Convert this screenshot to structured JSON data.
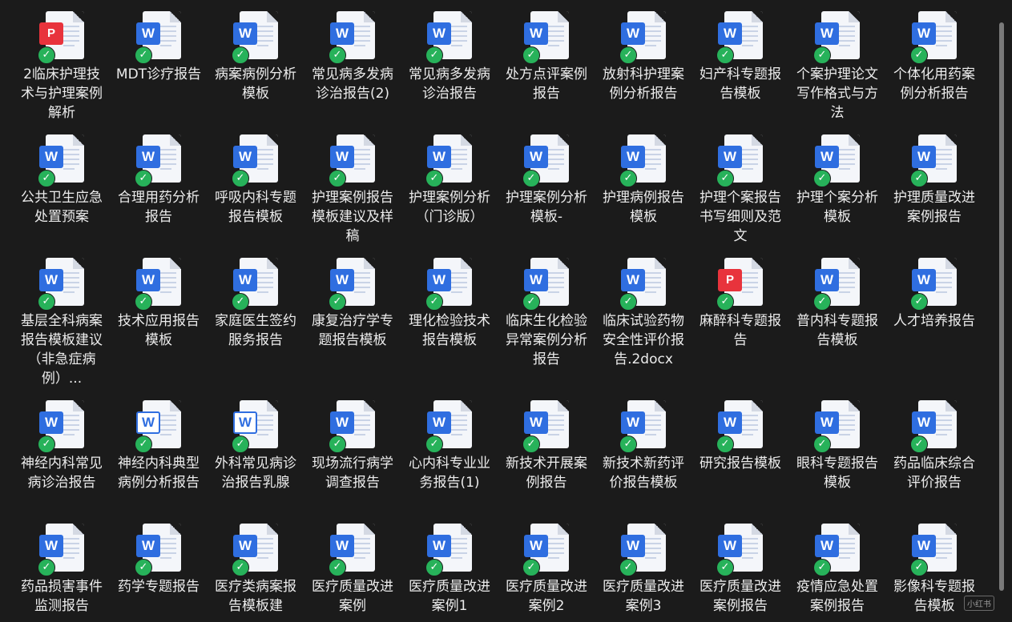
{
  "files": [
    {
      "name": "2临床护理技术与护理案例解析",
      "type": "wps"
    },
    {
      "name": "MDT诊疗报告",
      "type": "word"
    },
    {
      "name": "病案病例分析模板",
      "type": "word"
    },
    {
      "name": "常见病多发病诊治报告(2)",
      "type": "word"
    },
    {
      "name": "常见病多发病诊治报告",
      "type": "word"
    },
    {
      "name": "处方点评案例报告",
      "type": "word"
    },
    {
      "name": "放射科护理案例分析报告",
      "type": "word"
    },
    {
      "name": "妇产科专题报告模板",
      "type": "word"
    },
    {
      "name": "个案护理论文写作格式与方法",
      "type": "word"
    },
    {
      "name": "个体化用药案例分析报告",
      "type": "word"
    },
    {
      "name": "公共卫生应急处置预案",
      "type": "word"
    },
    {
      "name": "合理用药分析报告",
      "type": "word"
    },
    {
      "name": "呼吸内科专题报告模板",
      "type": "word"
    },
    {
      "name": "护理案例报告模板建议及样稿",
      "type": "word"
    },
    {
      "name": "护理案例分析（门诊版）",
      "type": "word"
    },
    {
      "name": "护理案例分析模板-",
      "type": "word"
    },
    {
      "name": "护理病例报告模板",
      "type": "word"
    },
    {
      "name": "护理个案报告书写细则及范文",
      "type": "word"
    },
    {
      "name": "护理个案分析模板",
      "type": "word"
    },
    {
      "name": "护理质量改进案例报告",
      "type": "word"
    },
    {
      "name": "基层全科病案报告模板建议（非急症病例）...",
      "type": "word"
    },
    {
      "name": "技术应用报告模板",
      "type": "word"
    },
    {
      "name": "家庭医生签约服务报告",
      "type": "word"
    },
    {
      "name": "康复治疗学专题报告模板",
      "type": "word"
    },
    {
      "name": "理化检验技术报告模板",
      "type": "word"
    },
    {
      "name": "临床生化检验异常案例分析报告",
      "type": "word"
    },
    {
      "name": "临床试验药物安全性评价报告.2docx",
      "type": "word"
    },
    {
      "name": "麻醉科专题报告",
      "type": "wps"
    },
    {
      "name": "普内科专题报告模板",
      "type": "word"
    },
    {
      "name": "人才培养报告",
      "type": "word"
    },
    {
      "name": "神经内科常见病诊治报告",
      "type": "word"
    },
    {
      "name": "神经内科典型病例分析报告",
      "type": "word-light"
    },
    {
      "name": "外科常见病诊治报告乳腺",
      "type": "word-light"
    },
    {
      "name": "现场流行病学调查报告",
      "type": "word"
    },
    {
      "name": "心内科专业业务报告(1)",
      "type": "word"
    },
    {
      "name": "新技术开展案例报告",
      "type": "word"
    },
    {
      "name": "新技术新药评价报告模板",
      "type": "word"
    },
    {
      "name": "研究报告模板",
      "type": "word"
    },
    {
      "name": "眼科专题报告模板",
      "type": "word"
    },
    {
      "name": "药品临床综合评价报告",
      "type": "word"
    },
    {
      "name": "药品损害事件监测报告",
      "type": "word"
    },
    {
      "name": "药学专题报告",
      "type": "word"
    },
    {
      "name": "医疗类病案报告模板建",
      "type": "word"
    },
    {
      "name": "医疗质量改进案例",
      "type": "word"
    },
    {
      "name": "医疗质量改进案例1",
      "type": "word"
    },
    {
      "name": "医疗质量改进案例2",
      "type": "word"
    },
    {
      "name": "医疗质量改进案例3",
      "type": "word"
    },
    {
      "name": "医疗质量改进案例报告",
      "type": "word"
    },
    {
      "name": "疫情应急处置案例报告",
      "type": "word"
    },
    {
      "name": "影像科专题报告模板",
      "type": "word"
    }
  ],
  "icons": {
    "word_letter": "W",
    "wps_letter": "P",
    "check": "✓"
  },
  "watermark": "小红书",
  "colors": {
    "background": "#1b1b1b",
    "word_blue": "#2f6ee0",
    "wps_red": "#e8333c",
    "sync_green": "#27b25a",
    "label_text": "#ececec"
  }
}
